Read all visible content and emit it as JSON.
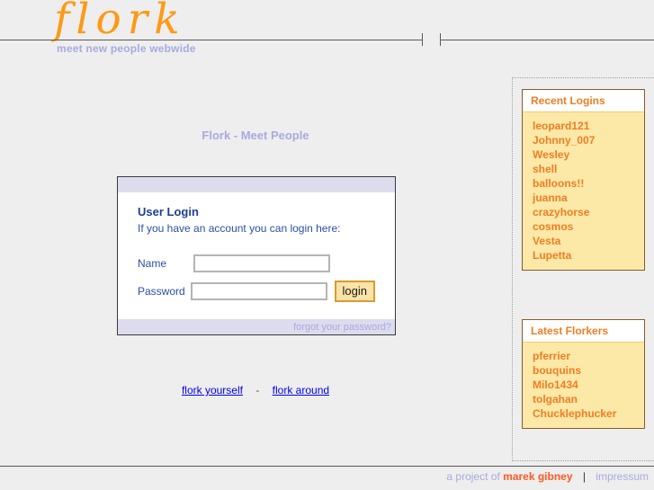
{
  "header": {
    "logo_text": "flork",
    "tagline": "meet new people webwide"
  },
  "main": {
    "page_title": "Flork - Meet People",
    "login": {
      "heading": "User Login",
      "subheading": "If you have an account you can login here:",
      "name_label": "Name",
      "name_value": "",
      "name_placeholder": "",
      "password_label": "Password",
      "password_value": "",
      "password_placeholder": "",
      "login_button": "login",
      "forgot_link": "forgot your password?"
    },
    "bottom_links": {
      "left": "flork yourself",
      "separator": "-",
      "right": "flork around"
    }
  },
  "sidebar": {
    "panels": [
      {
        "title": "Recent Logins",
        "items": [
          "leopard121",
          "Johnny_007",
          "Wesley",
          "shell",
          "balloons!!",
          "juanna",
          "crazyhorse",
          "cosmos",
          "Vesta",
          "Lupetta"
        ]
      },
      {
        "title": "Latest Florkers",
        "items": [
          "pferrier",
          "bouquins",
          "Milo1434",
          "tolgahan",
          "Chucklephucker"
        ]
      }
    ]
  },
  "footer": {
    "credit_prefix": "a project of",
    "credit_name": "marek gibney",
    "separator": "|",
    "impressum": "impressum"
  },
  "colors": {
    "page_background": "#eeeeee",
    "logo_orange": "#ff9914",
    "tagline_lavender": "#a9a9e0",
    "panel_yellow": "#fce9a8",
    "panel_border_brown": "#8a5b2c",
    "panel_text_orange": "#f07d22",
    "login_bar_lavender": "#dddcee",
    "login_heading_blue": "#1c3f94",
    "button_fill": "#fbe3a8",
    "button_border": "#d79b35",
    "link_blue": "#0000ee",
    "credit_orange": "#ff5a1f"
  }
}
